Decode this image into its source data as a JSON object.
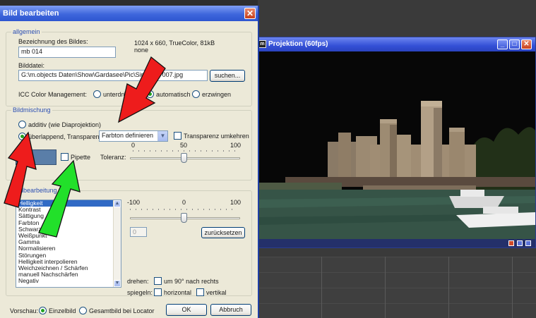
{
  "dialog": {
    "title": "Bild bearbeiten",
    "close_glyph": "✕",
    "allgemein": {
      "legend": "allgemein",
      "name_label": "Bezeichnung des Bildes:",
      "name_value": "mb 014",
      "info_line1": "1024 x 660, TrueColor, 81kB",
      "info_line2": "none",
      "file_label": "Bilddatei:",
      "file_value": "G:\\m.objects Daten\\Show\\Gardasee\\Pic\\Sirmione 007.jpg",
      "search_button": "suchen...",
      "icc_label": "ICC Color Management:",
      "icc_options": [
        "unterdrücken",
        "automatisch",
        "erzwingen"
      ]
    },
    "bildmischung": {
      "legend": "Bildmischung",
      "additiv_label": "additiv (wie Diaprojektion)",
      "ueberlappend_label": "überlappend, Transparenz:",
      "transparency_select": "Farbton definieren",
      "invert_label": "Transparenz umkehren",
      "pipette_label": "Pipette",
      "tolerance_label": "Toleranz:",
      "scale": [
        "0",
        "50",
        "100"
      ],
      "tolerance_value": 50
    },
    "bildbearbeitung": {
      "legend": "Bildbearbeitung",
      "items": [
        "Helligkeit",
        "Kontrast",
        "Sättigung",
        "Farbton",
        "Schwarzpunkt",
        "Weißpunkt",
        "Gamma",
        "Normalisieren",
        "Störungen",
        "Helligkeit interpolieren",
        "Weichzeichnen / Schärfen",
        "manuell Nachschärfen",
        "Negativ"
      ],
      "scale": [
        "-100",
        "0",
        "100"
      ],
      "slider_value": 0,
      "value_field": "0",
      "reset_button": "zurücksetzen",
      "rotate_label": "drehen:",
      "rotate_option": "um 90° nach rechts",
      "mirror_label": "spiegeln:",
      "mirror_options": [
        "horizontal",
        "vertikal"
      ]
    },
    "footer": {
      "preview_label": "Vorschau:",
      "preview_options": [
        "Einzelbild",
        "Gesamtbild bei Locator"
      ],
      "ok_button": "OK",
      "cancel_button": "Abbruch"
    }
  },
  "projection": {
    "title": "Projektion (60fps)",
    "app_icon": "m",
    "buttons": [
      "_",
      "□",
      "✕"
    ]
  },
  "colors": {
    "dialog_bg": "#ece9d8",
    "titlebar": "#3f67dc",
    "highlight": "#316ac5",
    "arrow_red": "#ee1c1c",
    "arrow_green": "#22e02a"
  }
}
